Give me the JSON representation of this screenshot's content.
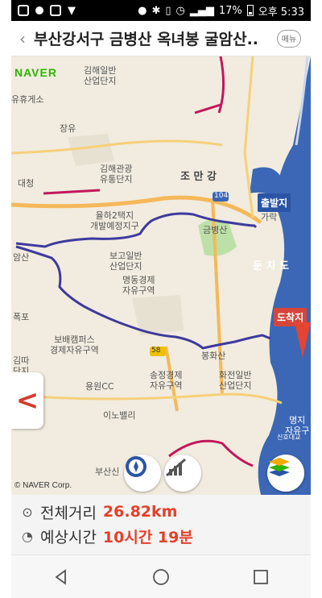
{
  "status_bar": {
    "battery": "17%",
    "time": "오후 5:33"
  },
  "header": {
    "title": "부산강서구 금병산 옥녀봉 굴암산..",
    "menu_label": "메뉴"
  },
  "map": {
    "logo": "NAVER",
    "copyright": "© NAVER Corp.",
    "start_marker": "출발지",
    "end_marker": "도착지",
    "labels": {
      "jangyu": "장유",
      "restarea": "유휴게소",
      "gimhae_ilban": "김해일반\n산업단지",
      "gimhae_gwangwang": "김해관광\n유통단지",
      "daecheong": "대청",
      "joman_gang": "조 만 강",
      "yulha": "율하2택지\n개발예정지구",
      "geumbyeongsan": "금병산",
      "gaakdong": "가락",
      "amsan": "암산",
      "bogoilban": "보고일반\n산업단지",
      "myeongdong": "명동경제\n자유구역",
      "dunchido": "둔 치 도",
      "pokpo": "폭포",
      "bohae": "보배캠퍼스\n경제자유구역",
      "jungsandanji": "김따\n단지",
      "bonghwasan": "봉화산",
      "songjeong": "송정경제\n자유구역",
      "hwajeon": "화전일반\n산업단지",
      "yongwon_cc": "용원CC",
      "inovalley": "이노밸리",
      "busan_sinsi": "부산신",
      "myeongji": "명지\n자유구",
      "road_58": "58",
      "road_104": "104",
      "sinhodanji": "신호대교"
    }
  },
  "info": {
    "distance_label": "전체거리",
    "distance_value": "26.82km",
    "time_label": "예상시간",
    "time_value": "10시간 19분"
  },
  "colors": {
    "route": "#3e3a9e",
    "river": "#3b67b6",
    "road_main": "#f5b85a",
    "bike_route": "#c2185b",
    "accent_red": "#e4402a"
  },
  "icons": {
    "back": "back-arrow-icon",
    "distance": "distance-icon",
    "time": "time-icon",
    "compass": "compass-icon",
    "elevation": "elevation-icon",
    "layers": "layers-icon"
  }
}
